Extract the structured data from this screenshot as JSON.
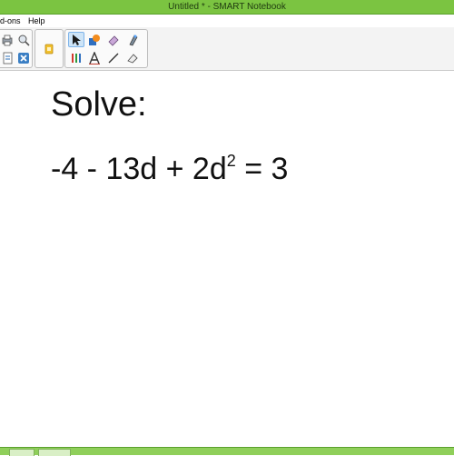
{
  "window": {
    "title": "Untitled * - SMART Notebook"
  },
  "menu": {
    "items": [
      "d-ons",
      "Help"
    ]
  },
  "toolbar": {
    "left_icons": [
      "print-icon",
      "screen-shade-icon",
      "document-icon",
      "delete-icon"
    ],
    "middle_icons": [
      "add-ons-icon"
    ],
    "tool_icons": [
      "select-arrow-icon",
      "shapes-icon",
      "eraser-icon",
      "magic-pen-icon",
      "pens-icon",
      "text-icon",
      "line-icon",
      "creative-eraser-icon"
    ],
    "selected_tool": "select-arrow-icon"
  },
  "page": {
    "title": "Solve:",
    "equation": {
      "part1": "-4 - 13d + 2d",
      "exponent": "2",
      "part2": " = 3"
    }
  },
  "colors": {
    "titlebar": "#7bc441",
    "taskbar": "#8fcf5a",
    "selected_tool_bg": "#cde4f7"
  }
}
